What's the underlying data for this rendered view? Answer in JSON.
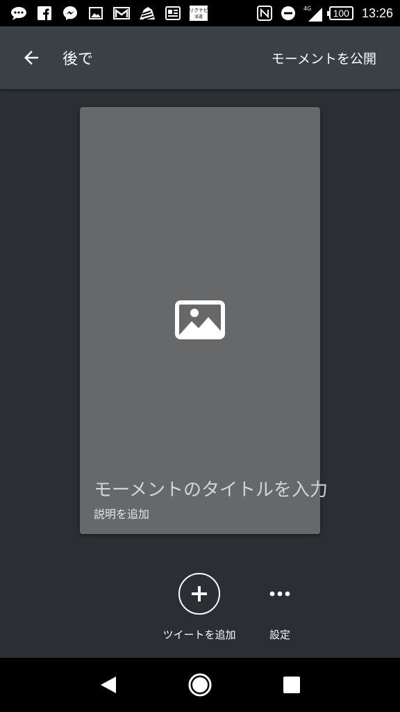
{
  "status_bar": {
    "time": "13:26",
    "battery": "100",
    "network": "4G",
    "icons": [
      "chat-icon",
      "facebook-icon",
      "messenger-icon",
      "gallery-icon",
      "gmail-icon",
      "zebra-icon",
      "news-icon",
      "rikunabi-icon",
      "nfc-icon",
      "dnd-icon",
      "signal-icon",
      "battery-icon"
    ],
    "app_badge_top": "リクナビ",
    "app_badge_bottom": "派遣"
  },
  "app_bar": {
    "back_icon": "arrow-back-icon",
    "title": "後で",
    "publish_label": "モーメントを公開"
  },
  "card": {
    "image_icon": "image-placeholder-icon",
    "title_placeholder": "モーメントのタイトルを入力",
    "description_placeholder": "説明を追加"
  },
  "actions": {
    "add_tweet_label": "ツイートを追加",
    "settings_label": "設定"
  },
  "nav_bar": {
    "icons": [
      "nav-back-icon",
      "nav-home-icon",
      "nav-recents-icon"
    ]
  },
  "colors": {
    "background": "#292f33",
    "app_bar": "#394147",
    "card": "#67686a"
  }
}
